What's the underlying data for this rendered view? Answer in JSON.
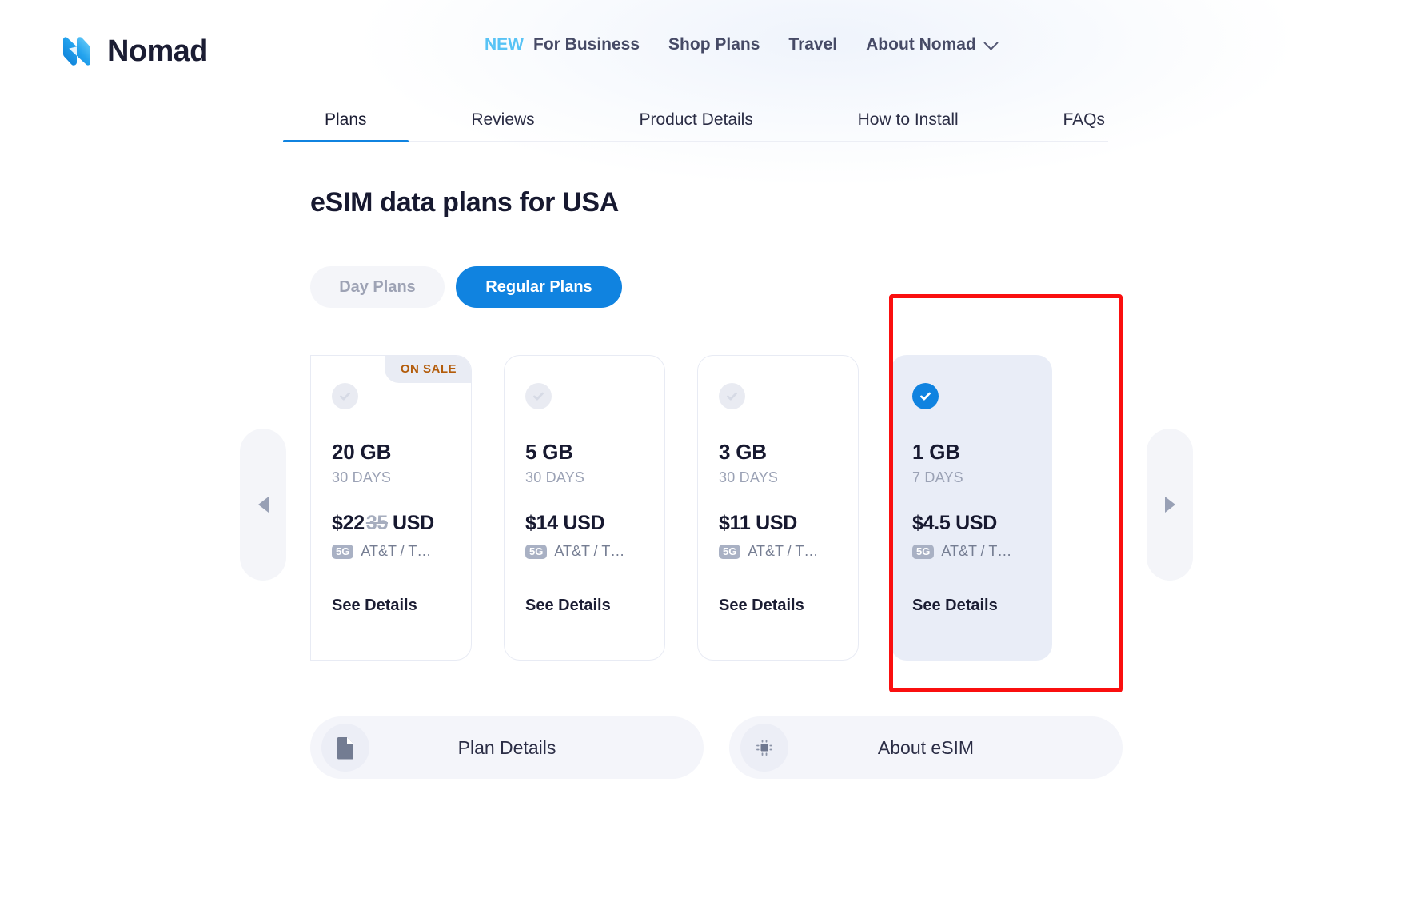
{
  "brand": {
    "name": "Nomad",
    "logo_icon": "nomad-n-logo",
    "logo_color_dark": "#1083e0",
    "logo_color_light": "#5ecbf9",
    "wordmark_color": "#1b1d33"
  },
  "topnav": {
    "new_label": "NEW",
    "new_color": "#58c3f5",
    "items": [
      {
        "label": "For Business"
      },
      {
        "label": "Shop Plans"
      },
      {
        "label": "Travel"
      },
      {
        "label": "About Nomad",
        "has_dropdown": true,
        "dropdown_icon": "chevron-down-icon"
      }
    ]
  },
  "tabs": {
    "active_index": 0,
    "active_underline_color": "#1083e0",
    "items": [
      {
        "label": "Plans"
      },
      {
        "label": "Reviews"
      },
      {
        "label": "Product Details"
      },
      {
        "label": "How to Install"
      },
      {
        "label": "FAQs"
      }
    ]
  },
  "heading": "eSIM data plans for USA",
  "plan_toggle": {
    "day_plans_label": "Day Plans",
    "regular_plans_label": "Regular Plans",
    "active": "Regular Plans",
    "active_bg": "#1083e0",
    "inactive_bg": "#f4f5f9"
  },
  "carousel": {
    "prev_icon": "arrow-left-icon",
    "next_icon": "arrow-right-icon",
    "plans": [
      {
        "size": "20 GB",
        "duration": "30 DAYS",
        "price": "$22",
        "price_old": "35",
        "currency": "USD",
        "network_badge": "5G",
        "network": "AT&T / T…",
        "details_label": "See Details",
        "sale_badge": "ON SALE",
        "sale_badge_color": "#b35c0a",
        "selected": false,
        "partial": true
      },
      {
        "size": "5 GB",
        "duration": "30 DAYS",
        "price": "$14",
        "price_old": "",
        "currency": "USD",
        "network_badge": "5G",
        "network": "AT&T / T…",
        "details_label": "See Details",
        "sale_badge": "",
        "selected": false,
        "partial": false
      },
      {
        "size": "3 GB",
        "duration": "30 DAYS",
        "price": "$11",
        "price_old": "",
        "currency": "USD",
        "network_badge": "5G",
        "network": "AT&T / T…",
        "details_label": "See Details",
        "sale_badge": "",
        "selected": false,
        "partial": false
      },
      {
        "size": "1 GB",
        "duration": "7 DAYS",
        "price": "$4.5",
        "price_old": "",
        "currency": "USD",
        "network_badge": "5G",
        "network": "AT&T / T…",
        "details_label": "See Details",
        "sale_badge": "",
        "selected": true,
        "partial": false
      }
    ]
  },
  "annotation": {
    "color": "#fa0f0f",
    "targets": "1 GB plan card"
  },
  "bottom_buttons": [
    {
      "label": "Plan Details",
      "icon": "document-icon"
    },
    {
      "label": "About eSIM",
      "icon": "sim-chip-icon"
    }
  ]
}
